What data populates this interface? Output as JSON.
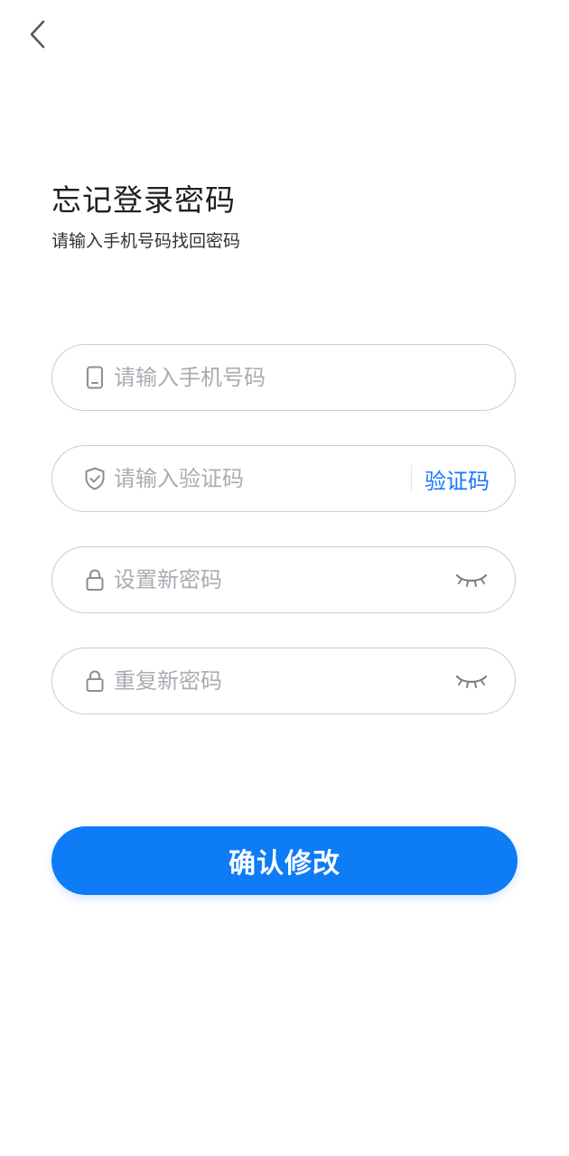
{
  "header": {
    "back_icon": "chevron-left-icon"
  },
  "page": {
    "title": "忘记登录密码",
    "subtitle": "请输入手机号码找回密码"
  },
  "form": {
    "phone": {
      "icon": "phone-icon",
      "placeholder": "请输入手机号码",
      "value": ""
    },
    "code": {
      "icon": "shield-icon",
      "placeholder": "请输入验证码",
      "value": "",
      "action_label": "验证码"
    },
    "new_password": {
      "icon": "lock-icon",
      "placeholder": "设置新密码",
      "value": "",
      "toggle_icon": "eye-closed-icon"
    },
    "repeat_password": {
      "icon": "lock-icon",
      "placeholder": "重复新密码",
      "value": "",
      "toggle_icon": "eye-closed-icon"
    },
    "submit_label": "确认修改"
  },
  "colors": {
    "accent": "#0e7bf7",
    "link": "#1677ff",
    "placeholder": "#a9acb2",
    "border": "#c8cbd0"
  }
}
